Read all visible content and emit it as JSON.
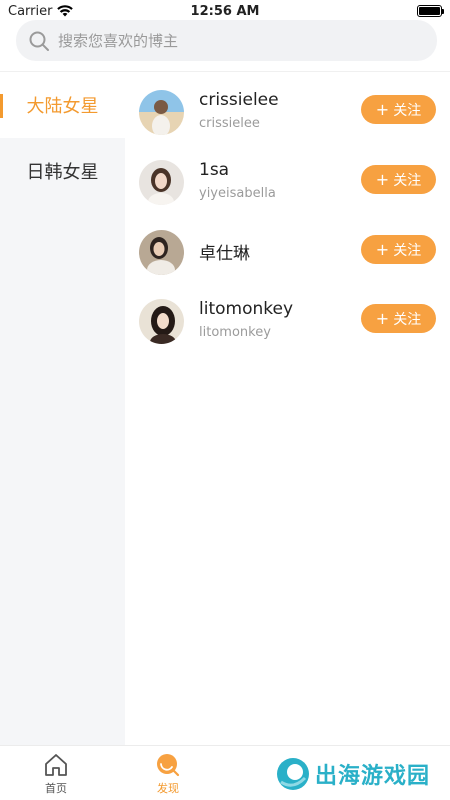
{
  "status_bar": {
    "carrier": "Carrier",
    "time": "12:56 AM"
  },
  "search": {
    "placeholder": "搜索您喜欢的博主"
  },
  "sidebar": {
    "items": [
      {
        "label": "大陆女星",
        "active": true
      },
      {
        "label": "日韩女星",
        "active": false
      }
    ]
  },
  "bloggers": [
    {
      "name": "crissielee",
      "handle": "crissielee",
      "follow_label": "关注"
    },
    {
      "name": "1sa",
      "handle": "yiyeisabella",
      "follow_label": "关注"
    },
    {
      "name": "卓仕琳",
      "handle": "",
      "follow_label": "关注"
    },
    {
      "name": "litomonkey",
      "handle": "litomonkey",
      "follow_label": "关注"
    }
  ],
  "tabbar": {
    "tabs": [
      {
        "label": "首页",
        "icon": "home-icon",
        "active": false
      },
      {
        "label": "发现",
        "icon": "discover-icon",
        "active": true
      }
    ],
    "watermark": "出海游戏园"
  },
  "colors": {
    "accent": "#f39a2f",
    "follow_button": "#f7a141",
    "sidebar_bg": "#f5f6f8",
    "watermark": "#2ab0c8"
  }
}
